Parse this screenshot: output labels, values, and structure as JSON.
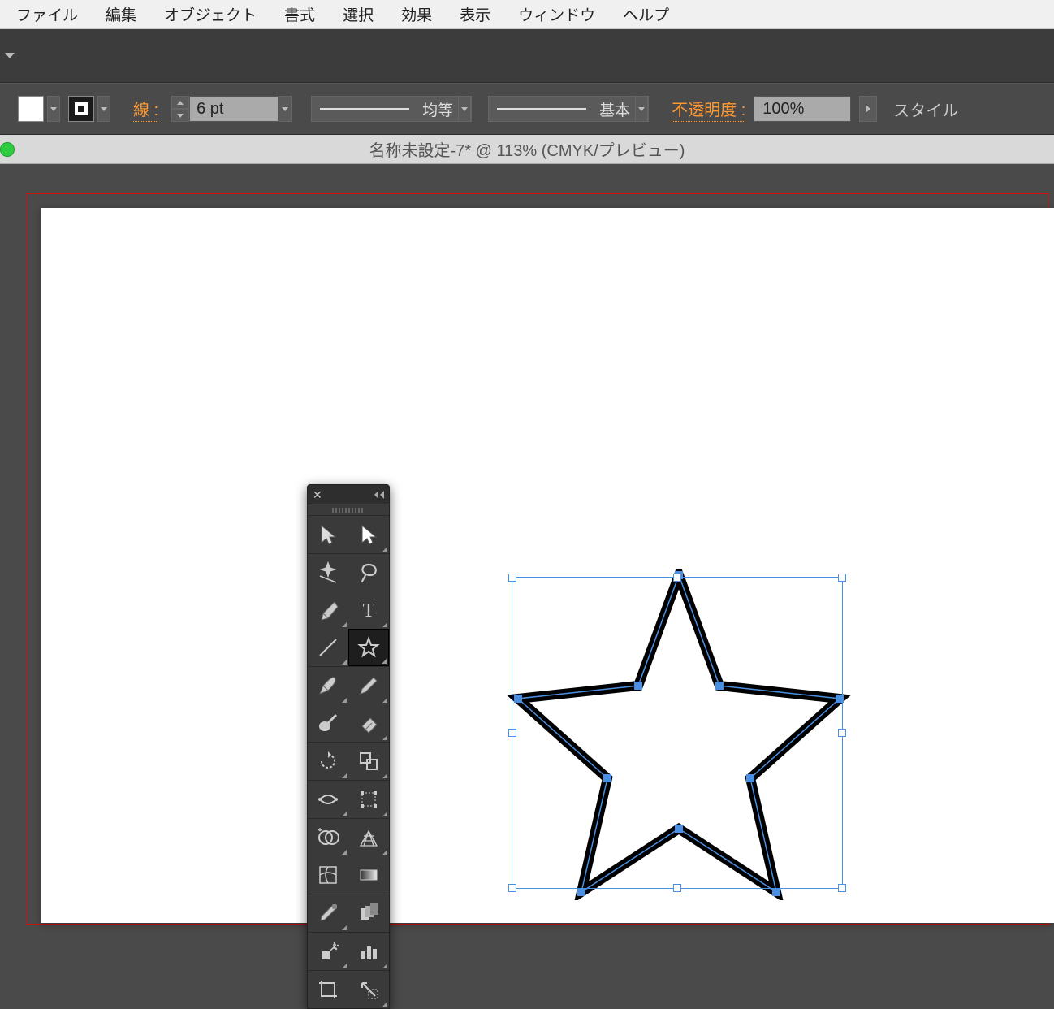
{
  "menubar": {
    "file": "ファイル",
    "edit": "編集",
    "object": "オブジェクト",
    "type": "書式",
    "select": "選択",
    "effect": "効果",
    "view": "表示",
    "window": "ウィンドウ",
    "help": "ヘルプ"
  },
  "controlbar": {
    "stroke_label": "線 :",
    "stroke_value": "6 pt",
    "profile": "均等",
    "brush": "基本",
    "opacity_label": "不透明度 :",
    "opacity_value": "100%",
    "style_label": "スタイル"
  },
  "document": {
    "title": "名称未設定-7* @ 113% (CMYK/プレビュー)"
  },
  "tools": [
    {
      "name": "selection-tool",
      "active": false,
      "flyout": false
    },
    {
      "name": "direct-selection-tool",
      "active": false,
      "flyout": true
    },
    {
      "name": "magic-wand-tool",
      "active": false,
      "flyout": false
    },
    {
      "name": "lasso-tool",
      "active": false,
      "flyout": false
    },
    {
      "name": "pen-tool",
      "active": false,
      "flyout": true
    },
    {
      "name": "type-tool",
      "active": false,
      "flyout": true
    },
    {
      "name": "line-tool",
      "active": false,
      "flyout": true
    },
    {
      "name": "star-tool",
      "active": true,
      "flyout": true
    },
    {
      "name": "paintbrush-tool",
      "active": false,
      "flyout": true
    },
    {
      "name": "pencil-tool",
      "active": false,
      "flyout": true
    },
    {
      "name": "blob-brush-tool",
      "active": false,
      "flyout": false
    },
    {
      "name": "eraser-tool",
      "active": false,
      "flyout": true
    },
    {
      "name": "rotate-tool",
      "active": false,
      "flyout": true
    },
    {
      "name": "scale-tool",
      "active": false,
      "flyout": true
    },
    {
      "name": "width-tool",
      "active": false,
      "flyout": true
    },
    {
      "name": "free-transform-tool",
      "active": false,
      "flyout": true
    },
    {
      "name": "shape-builder-tool",
      "active": false,
      "flyout": true
    },
    {
      "name": "perspective-grid-tool",
      "active": false,
      "flyout": true
    },
    {
      "name": "mesh-tool",
      "active": false,
      "flyout": false
    },
    {
      "name": "gradient-tool",
      "active": false,
      "flyout": false
    },
    {
      "name": "eyedropper-tool",
      "active": false,
      "flyout": true
    },
    {
      "name": "blend-tool",
      "active": false,
      "flyout": false
    },
    {
      "name": "symbol-sprayer-tool",
      "active": false,
      "flyout": true
    },
    {
      "name": "column-graph-tool",
      "active": false,
      "flyout": true
    },
    {
      "name": "artboard-tool",
      "active": false,
      "flyout": false
    },
    {
      "name": "slice-tool",
      "active": false,
      "flyout": true
    }
  ],
  "canvas_object": {
    "shape": "star",
    "points": 5,
    "fill": "#ffffff",
    "stroke": "#000000",
    "stroke_width": "6pt",
    "selected": true
  }
}
